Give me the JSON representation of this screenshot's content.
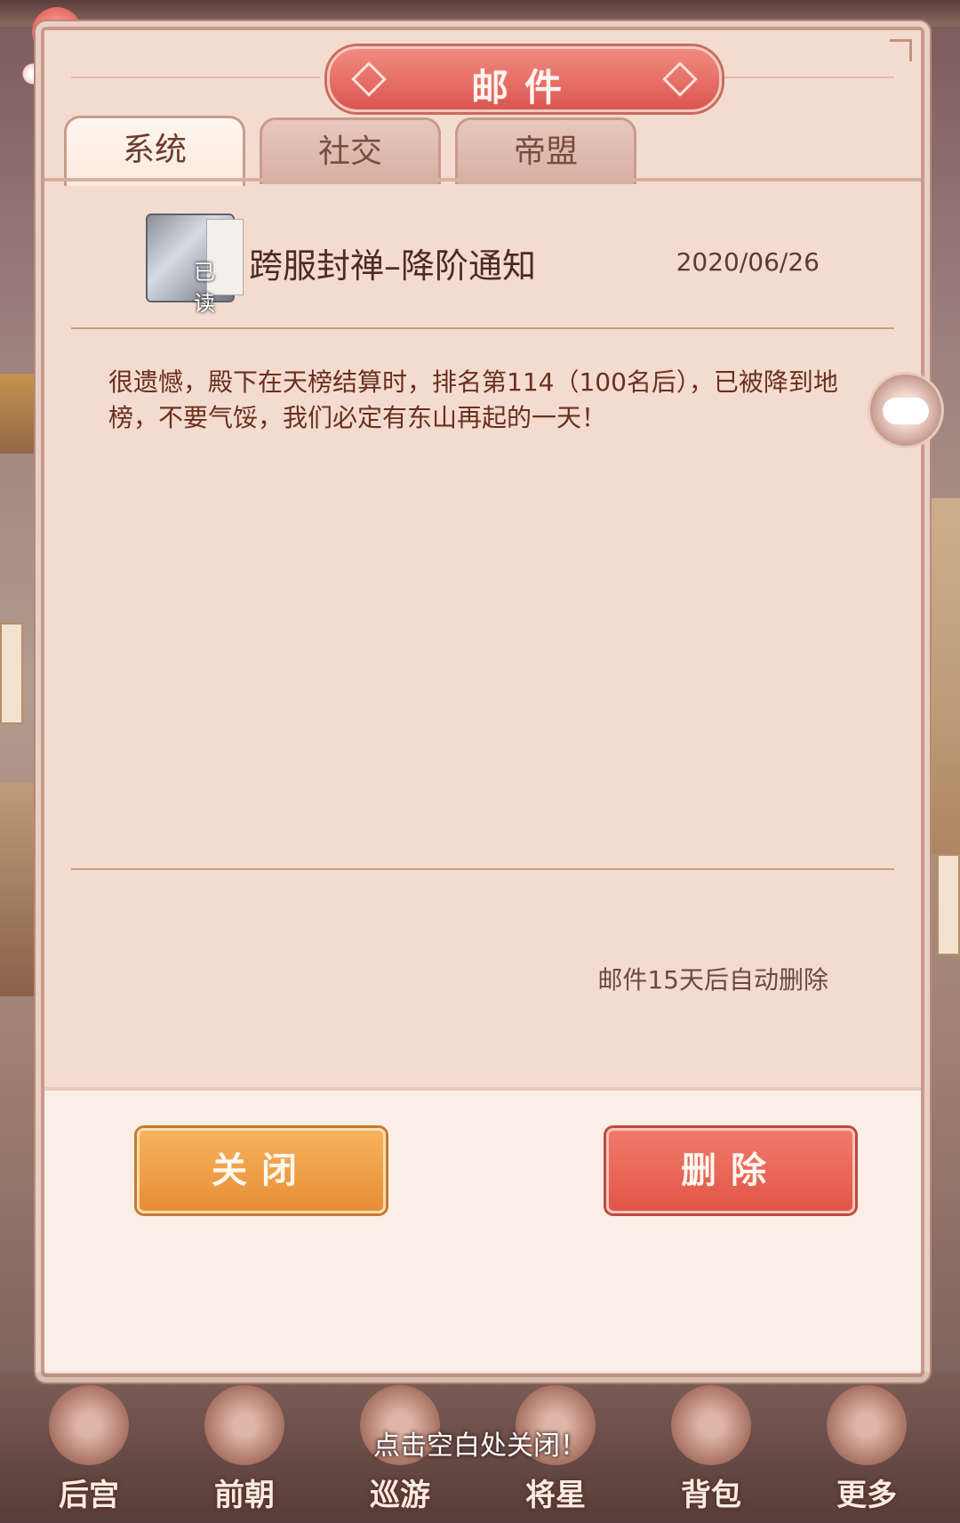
{
  "dialog": {
    "title": "邮件",
    "tabs": [
      {
        "label": "系统",
        "active": true
      },
      {
        "label": "社交",
        "active": false
      },
      {
        "label": "帝盟",
        "active": false
      }
    ],
    "mail": {
      "icon": "scroll-book-icon",
      "read_status": "已读",
      "subject": "跨服封禅–降阶通知",
      "date": "2020/06/26",
      "body": "很遗憾，殿下在天榜结算时，排名第114（100名后），已被降到地榜，不要气馁，我们必定有东山再起的一天！",
      "auto_delete_note": "邮件15天后自动删除"
    },
    "buttons": {
      "close": "关闭",
      "delete": "删除"
    }
  },
  "chat_button": {
    "icon": "chat-bubble-icon"
  },
  "hint": "点击空白处关闭！",
  "bottom_nav": [
    {
      "label": "后宫",
      "icon": "harem-icon"
    },
    {
      "label": "前朝",
      "icon": "court-icon"
    },
    {
      "label": "巡游",
      "icon": "travel-icon"
    },
    {
      "label": "将星",
      "icon": "general-icon"
    },
    {
      "label": "背包",
      "icon": "bag-icon"
    },
    {
      "label": "更多",
      "icon": "more-icon"
    }
  ],
  "colors": {
    "dialog_bg": "#f3dccf",
    "title_banner": "#e56c63",
    "close_button": "#e68e37",
    "delete_button": "#e15548"
  }
}
